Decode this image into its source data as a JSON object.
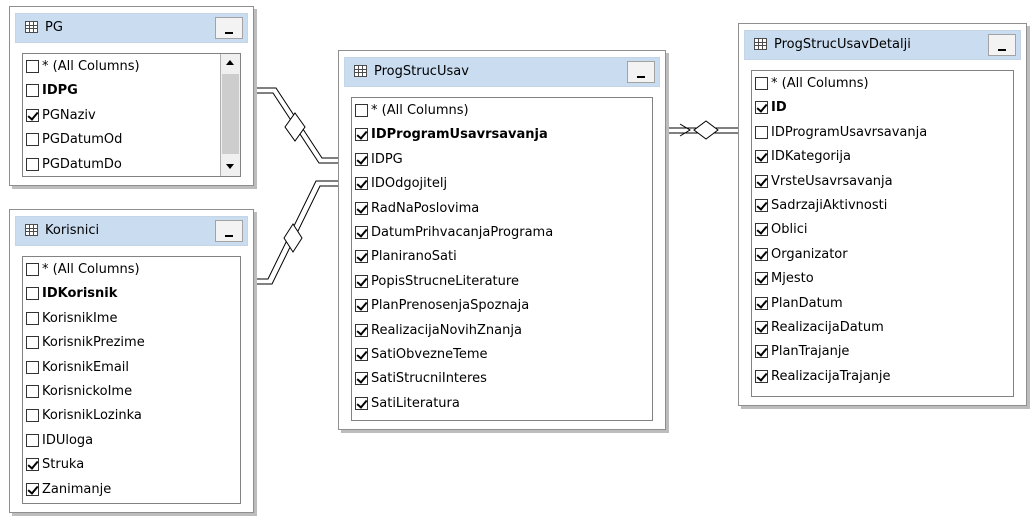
{
  "tables": {
    "pg": {
      "title": "PG",
      "columns": [
        {
          "name": "* (All Columns)",
          "checked": false,
          "pk": false
        },
        {
          "name": "IDPG",
          "checked": false,
          "pk": true
        },
        {
          "name": "PGNaziv",
          "checked": true,
          "pk": false
        },
        {
          "name": "PGDatumOd",
          "checked": false,
          "pk": false
        },
        {
          "name": "PGDatumDo",
          "checked": false,
          "pk": false
        }
      ]
    },
    "korisnici": {
      "title": "Korisnici",
      "columns": [
        {
          "name": "* (All Columns)",
          "checked": false,
          "pk": false
        },
        {
          "name": "IDKorisnik",
          "checked": false,
          "pk": true
        },
        {
          "name": "KorisnikIme",
          "checked": false,
          "pk": false
        },
        {
          "name": "KorisnikPrezime",
          "checked": false,
          "pk": false
        },
        {
          "name": "KorisnikEmail",
          "checked": false,
          "pk": false
        },
        {
          "name": "KorisnickoIme",
          "checked": false,
          "pk": false
        },
        {
          "name": "KorisnikLozinka",
          "checked": false,
          "pk": false
        },
        {
          "name": "IDUloga",
          "checked": false,
          "pk": false
        },
        {
          "name": "Struka",
          "checked": true,
          "pk": false
        },
        {
          "name": "Zanimanje",
          "checked": true,
          "pk": false
        }
      ]
    },
    "progstrucusav": {
      "title": "ProgStrucUsav",
      "columns": [
        {
          "name": "* (All Columns)",
          "checked": false,
          "pk": false
        },
        {
          "name": "IDProgramUsavrsavanja",
          "checked": true,
          "pk": true
        },
        {
          "name": "IDPG",
          "checked": true,
          "pk": false
        },
        {
          "name": "IDOdgojitelj",
          "checked": true,
          "pk": false
        },
        {
          "name": "RadNaPoslovima",
          "checked": true,
          "pk": false
        },
        {
          "name": "DatumPrihvacanjaPrograma",
          "checked": true,
          "pk": false
        },
        {
          "name": "PlaniranoSati",
          "checked": true,
          "pk": false
        },
        {
          "name": "PopisStrucneLiterature",
          "checked": true,
          "pk": false
        },
        {
          "name": "PlanPrenosenjaSpoznaja",
          "checked": true,
          "pk": false
        },
        {
          "name": "RealizacijaNovihZnanja",
          "checked": true,
          "pk": false
        },
        {
          "name": "SatiObvezneTeme",
          "checked": true,
          "pk": false
        },
        {
          "name": "SatiStrucniInteres",
          "checked": true,
          "pk": false
        },
        {
          "name": "SatiLiteratura",
          "checked": true,
          "pk": false
        }
      ]
    },
    "progstrucusavdetalji": {
      "title": "ProgStrucUsavDetalji",
      "columns": [
        {
          "name": "* (All Columns)",
          "checked": false,
          "pk": false
        },
        {
          "name": "ID",
          "checked": true,
          "pk": true
        },
        {
          "name": "IDProgramUsavrsavanja",
          "checked": false,
          "pk": false
        },
        {
          "name": "IDKategorija",
          "checked": true,
          "pk": false
        },
        {
          "name": "VrsteUsavrsavanja",
          "checked": true,
          "pk": false
        },
        {
          "name": "SadrzajiAktivnosti",
          "checked": true,
          "pk": false
        },
        {
          "name": "Oblici",
          "checked": true,
          "pk": false
        },
        {
          "name": "Organizator",
          "checked": true,
          "pk": false
        },
        {
          "name": "Mjesto",
          "checked": true,
          "pk": false
        },
        {
          "name": "PlanDatum",
          "checked": true,
          "pk": false
        },
        {
          "name": "RealizacijaDatum",
          "checked": true,
          "pk": false
        },
        {
          "name": "PlanTrajanje",
          "checked": true,
          "pk": false
        },
        {
          "name": "RealizacijaTrajanje",
          "checked": true,
          "pk": false
        }
      ]
    }
  },
  "colors": {
    "titlebar": "#c9dcf0",
    "border": "#8e8f8f",
    "connector": "#000000"
  }
}
